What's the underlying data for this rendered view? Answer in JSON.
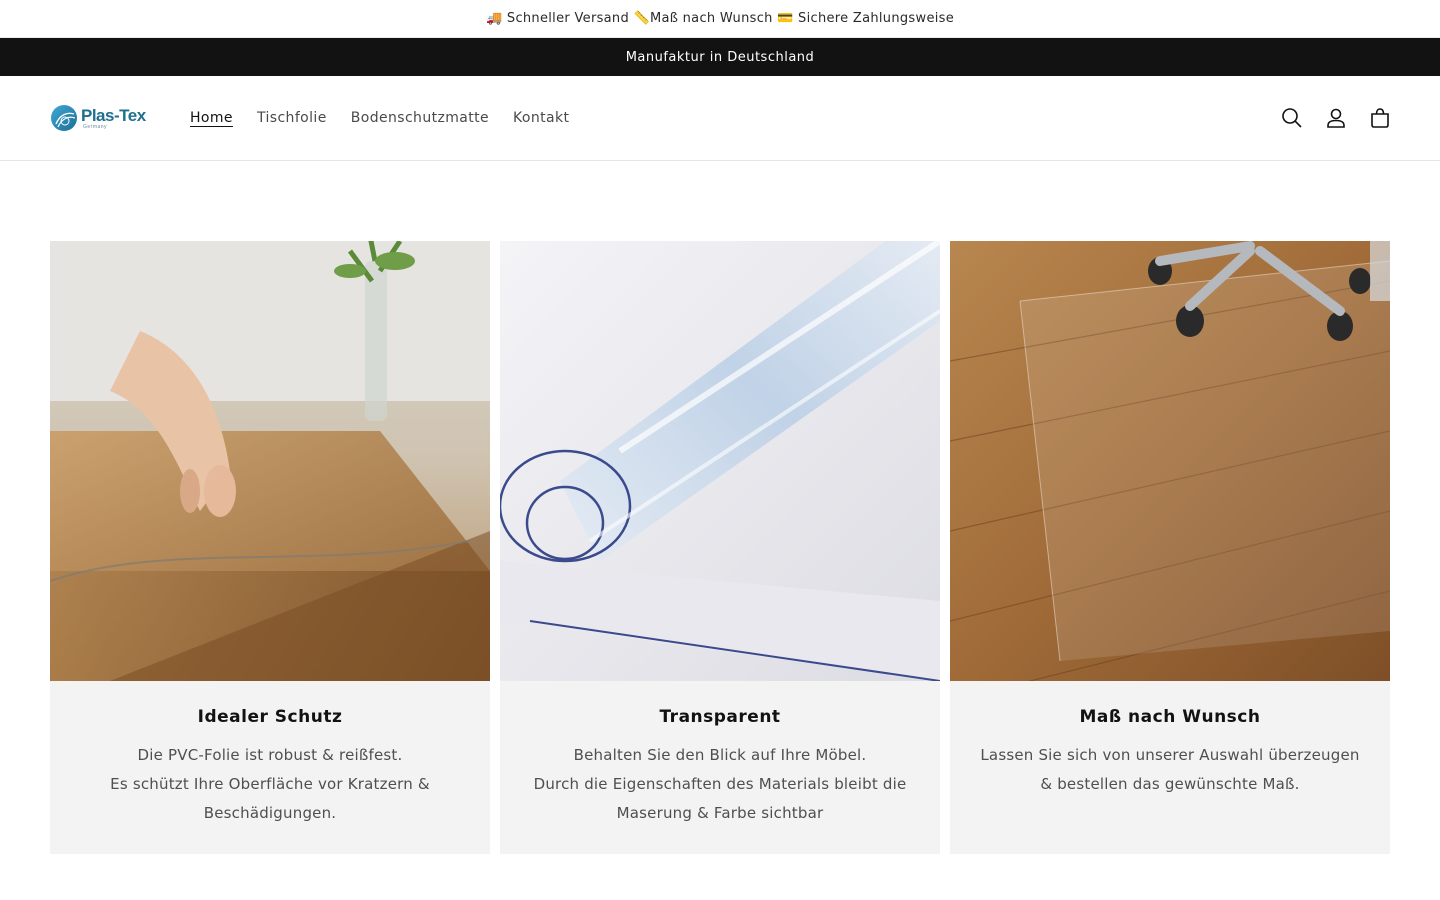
{
  "announcement_top": {
    "text": "🚚 Schneller Versand 📏Maß nach Wunsch 💳 Sichere Zahlungsweise"
  },
  "announcement_bar": {
    "text": "Manufaktur in Deutschland"
  },
  "header": {
    "logo_word_a": "Plas",
    "logo_word_dash": "-",
    "logo_word_b": "Tex",
    "logo_sub": "Germany",
    "nav": [
      {
        "label": "Home",
        "active": true
      },
      {
        "label": "Tischfolie"
      },
      {
        "label": "Bodenschutzmatte"
      },
      {
        "label": "Kontakt"
      }
    ],
    "icons": [
      "search-icon",
      "account-icon",
      "cart-icon"
    ]
  },
  "cards": [
    {
      "title": "Idealer Schutz",
      "lines": [
        "Die PVC-Folie ist robust & reißfest.",
        "Es schützt Ihre Oberfläche vor Kratzern & Beschädigungen."
      ]
    },
    {
      "title": "Transparent",
      "lines": [
        "Behalten Sie den Blick auf Ihre Möbel.",
        "Durch die Eigenschaften des Materials bleibt die Maserung & Farbe sichtbar"
      ]
    },
    {
      "title": "Maß nach Wunsch",
      "lines": [
        "Lassen Sie sich von unserer Auswahl überzeugen & bestellen das gewünschte Maß."
      ]
    }
  ],
  "colors": {
    "announcement_bg": "#121212",
    "brand": "#1f6f8f",
    "card_bg": "#f3f3f3"
  }
}
